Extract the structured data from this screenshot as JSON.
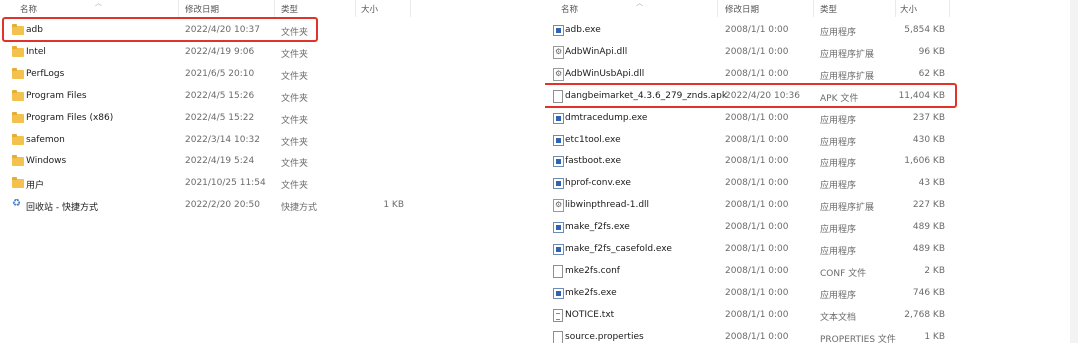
{
  "left": {
    "columns": {
      "name": "名称",
      "date": "修改日期",
      "type": "类型",
      "size": "大小"
    },
    "rows": [
      {
        "name": "adb",
        "date": "2022/4/20 10:37",
        "type": "文件夹",
        "size": "",
        "icon": "folder-icon"
      },
      {
        "name": "Intel",
        "date": "2022/4/19 9:06",
        "type": "文件夹",
        "size": "",
        "icon": "folder-icon"
      },
      {
        "name": "PerfLogs",
        "date": "2021/6/5 20:10",
        "type": "文件夹",
        "size": "",
        "icon": "folder-icon"
      },
      {
        "name": "Program Files",
        "date": "2022/4/5 15:26",
        "type": "文件夹",
        "size": "",
        "icon": "folder-icon"
      },
      {
        "name": "Program Files (x86)",
        "date": "2022/4/5 15:22",
        "type": "文件夹",
        "size": "",
        "icon": "folder-icon"
      },
      {
        "name": "safemon",
        "date": "2022/3/14 10:32",
        "type": "文件夹",
        "size": "",
        "icon": "folder-icon"
      },
      {
        "name": "Windows",
        "date": "2022/4/19 5:24",
        "type": "文件夹",
        "size": "",
        "icon": "folder-icon"
      },
      {
        "name": "用户",
        "date": "2021/10/25 11:54",
        "type": "文件夹",
        "size": "",
        "icon": "folder-icon"
      },
      {
        "name": "回收站 - 快捷方式",
        "date": "2022/2/20 20:50",
        "type": "快捷方式",
        "size": "1 KB",
        "icon": "recycle-bin-icon"
      }
    ]
  },
  "right": {
    "columns": {
      "name": "名称",
      "date": "修改日期",
      "type": "类型",
      "size": "大小"
    },
    "rows": [
      {
        "name": "adb.exe",
        "date": "2008/1/1 0:00",
        "type": "应用程序",
        "size": "5,854 KB",
        "icon": "exe-icon"
      },
      {
        "name": "AdbWinApi.dll",
        "date": "2008/1/1 0:00",
        "type": "应用程序扩展",
        "size": "96 KB",
        "icon": "dll-icon"
      },
      {
        "name": "AdbWinUsbApi.dll",
        "date": "2008/1/1 0:00",
        "type": "应用程序扩展",
        "size": "62 KB",
        "icon": "dll-icon"
      },
      {
        "name": "dangbeimarket_4.3.6_279_znds.apk",
        "date": "2022/4/20 10:36",
        "type": "APK 文件",
        "size": "11,404 KB",
        "icon": "file-icon"
      },
      {
        "name": "dmtracedump.exe",
        "date": "2008/1/1 0:00",
        "type": "应用程序",
        "size": "237 KB",
        "icon": "exe-icon"
      },
      {
        "name": "etc1tool.exe",
        "date": "2008/1/1 0:00",
        "type": "应用程序",
        "size": "430 KB",
        "icon": "exe-icon"
      },
      {
        "name": "fastboot.exe",
        "date": "2008/1/1 0:00",
        "type": "应用程序",
        "size": "1,606 KB",
        "icon": "exe-icon"
      },
      {
        "name": "hprof-conv.exe",
        "date": "2008/1/1 0:00",
        "type": "应用程序",
        "size": "43 KB",
        "icon": "exe-icon"
      },
      {
        "name": "libwinpthread-1.dll",
        "date": "2008/1/1 0:00",
        "type": "应用程序扩展",
        "size": "227 KB",
        "icon": "dll-icon"
      },
      {
        "name": "make_f2fs.exe",
        "date": "2008/1/1 0:00",
        "type": "应用程序",
        "size": "489 KB",
        "icon": "exe-icon"
      },
      {
        "name": "make_f2fs_casefold.exe",
        "date": "2008/1/1 0:00",
        "type": "应用程序",
        "size": "489 KB",
        "icon": "exe-icon"
      },
      {
        "name": "mke2fs.conf",
        "date": "2008/1/1 0:00",
        "type": "CONF 文件",
        "size": "2 KB",
        "icon": "file-icon"
      },
      {
        "name": "mke2fs.exe",
        "date": "2008/1/1 0:00",
        "type": "应用程序",
        "size": "746 KB",
        "icon": "exe-icon"
      },
      {
        "name": "NOTICE.txt",
        "date": "2008/1/1 0:00",
        "type": "文本文档",
        "size": "2,768 KB",
        "icon": "text-file-icon"
      },
      {
        "name": "source.properties",
        "date": "2008/1/1 0:00",
        "type": "PROPERTIES 文件",
        "size": "1 KB",
        "icon": "file-icon"
      }
    ]
  },
  "highlight_color": "#e0342b",
  "highlighted": [
    "adb",
    "dangbeimarket_4.3.6_279_znds.apk"
  ]
}
